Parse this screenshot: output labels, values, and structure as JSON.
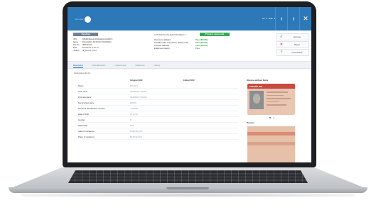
{
  "header": {
    "logo_text": "mrz.one",
    "user": "Mr. e - Allis",
    "prev_icon": "chevron-left",
    "next_icon": "chevron-right",
    "close_icon": "close"
  },
  "summary": {
    "status": "Pending",
    "fields": [
      {
        "k": "ID #",
        "v": "21BDBF8E2a4n4R4E4E4A-8A4B4F0"
      },
      {
        "k": "Name",
        "v": "ROCHARDO MARIANO SEREMEO"
      },
      {
        "k": "Doc.No",
        "v": "YBRE00139"
      },
      {
        "k": "Date",
        "v": "2021/05/07 11:00:23"
      },
      {
        "k": "Verifyer",
        "v": "Cli_RDvedy_2021"
      }
    ],
    "auto_label": "AUTOMATIC VALIDATION RESULT",
    "auto_result": "Process Approved",
    "checks": [
      {
        "k": "Document validation",
        "v": "Pass (88.93%)"
      },
      {
        "k": "Face/Biometric comparison, (Selfie vs ID)",
        "v": "Pass (89.53%)"
      },
      {
        "k": "Liveness detected",
        "v": "Pass (99.87%)"
      },
      {
        "k": "Evidences integrity",
        "v": "Pass"
      }
    ],
    "actions": [
      {
        "icon": "✓",
        "label": "Approve",
        "color": "#34a853"
      },
      {
        "icon": "✕",
        "label": "Reject",
        "color": "#e04848"
      },
      {
        "icon": "?",
        "label": "Inconclusive",
        "color": "#e09a2b"
      }
    ]
  },
  "tabs": [
    "Document",
    "Face Biometric",
    "Liveness test",
    "Evidences",
    "Library"
  ],
  "content": {
    "title": "Verifications list for",
    "col_original": "Original OCR",
    "col_edited": "Edited OCR",
    "col_doc": "Obverse without frame",
    "rows": [
      {
        "label": "Name",
        "ocr": "RICARD"
      },
      {
        "label": "Last name",
        "ocr": "SERMENT MARIN"
      },
      {
        "label": "First last name",
        "ocr": "SERMENT MARIN"
      },
      {
        "label": "Second last name",
        "ocr": "MARIN"
      },
      {
        "label": "Personal identification number",
        "ocr": "Y000030"
      },
      {
        "label": "Date of birth",
        "ocr": "01.11.62"
      },
      {
        "label": "Gender",
        "ocr": "M"
      },
      {
        "label": "Nationality",
        "ocr": "ESP"
      },
      {
        "label": "State of residence",
        "ocr": "BARCELONA"
      },
      {
        "label": "Place of residence",
        "ocr": "BARCELONA"
      }
    ],
    "card_label": "ESPAÑA DNI",
    "reverse_label": "Reverse"
  }
}
